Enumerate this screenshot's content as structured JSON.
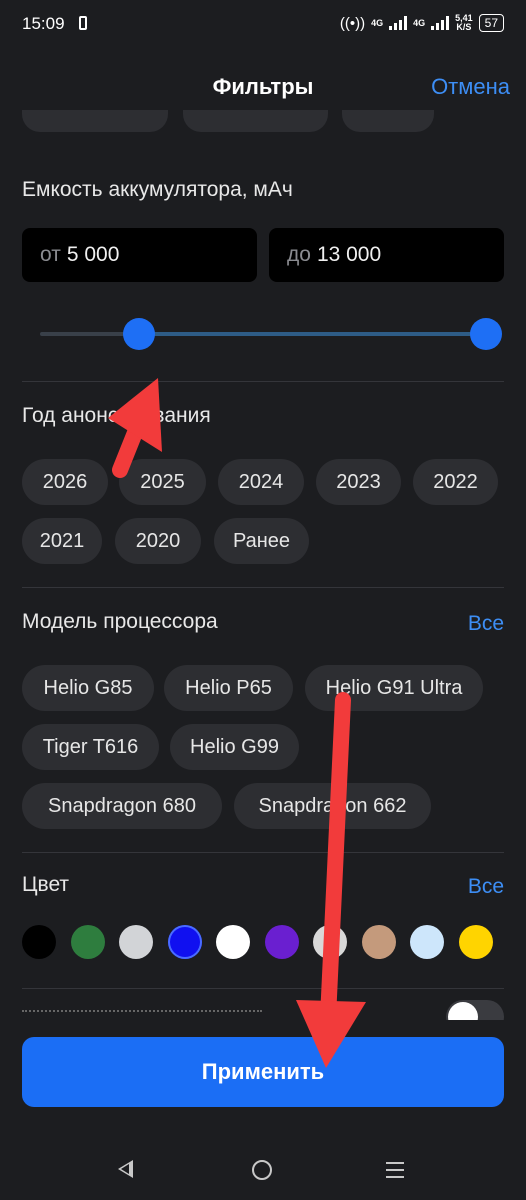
{
  "status_bar": {
    "time": "15:09",
    "network_1": "4G",
    "network_2": "4G",
    "speed_value": "5,41",
    "speed_unit": "K/S",
    "battery": "57"
  },
  "header": {
    "title": "Фильтры",
    "cancel_label": "Отмена"
  },
  "battery_capacity": {
    "title": "Емкость аккумулятора,  мАч",
    "from_prefix": "от",
    "from_value": "5 000",
    "to_prefix": "до",
    "to_value": "13 000",
    "slider_range": [
      0.222,
      1.0
    ]
  },
  "announce_year": {
    "title": "Год анонсирования",
    "options": [
      "2026",
      "2025",
      "2024",
      "2023",
      "2022",
      "2021",
      "2020",
      "Ранее"
    ]
  },
  "processor": {
    "title": "Модель процессора",
    "all_label": "Все",
    "options": [
      "Helio G85",
      "Helio P65",
      "Helio G91 Ultra",
      "Tiger T616",
      "Helio G99",
      "Snapdragon 680",
      "Snapdragon 662"
    ]
  },
  "color": {
    "title": "Цвет",
    "all_label": "Все",
    "swatches": [
      "#000000",
      "#2e7d3e",
      "#d2d4d7",
      "#1010f0",
      "#ffffff",
      "#6a1fd0",
      "#d9d9d9",
      "#c49a7c",
      "#cde6fb",
      "#ffd400"
    ]
  },
  "apply_label": "Применить",
  "annotation_color": "#f23b3b"
}
